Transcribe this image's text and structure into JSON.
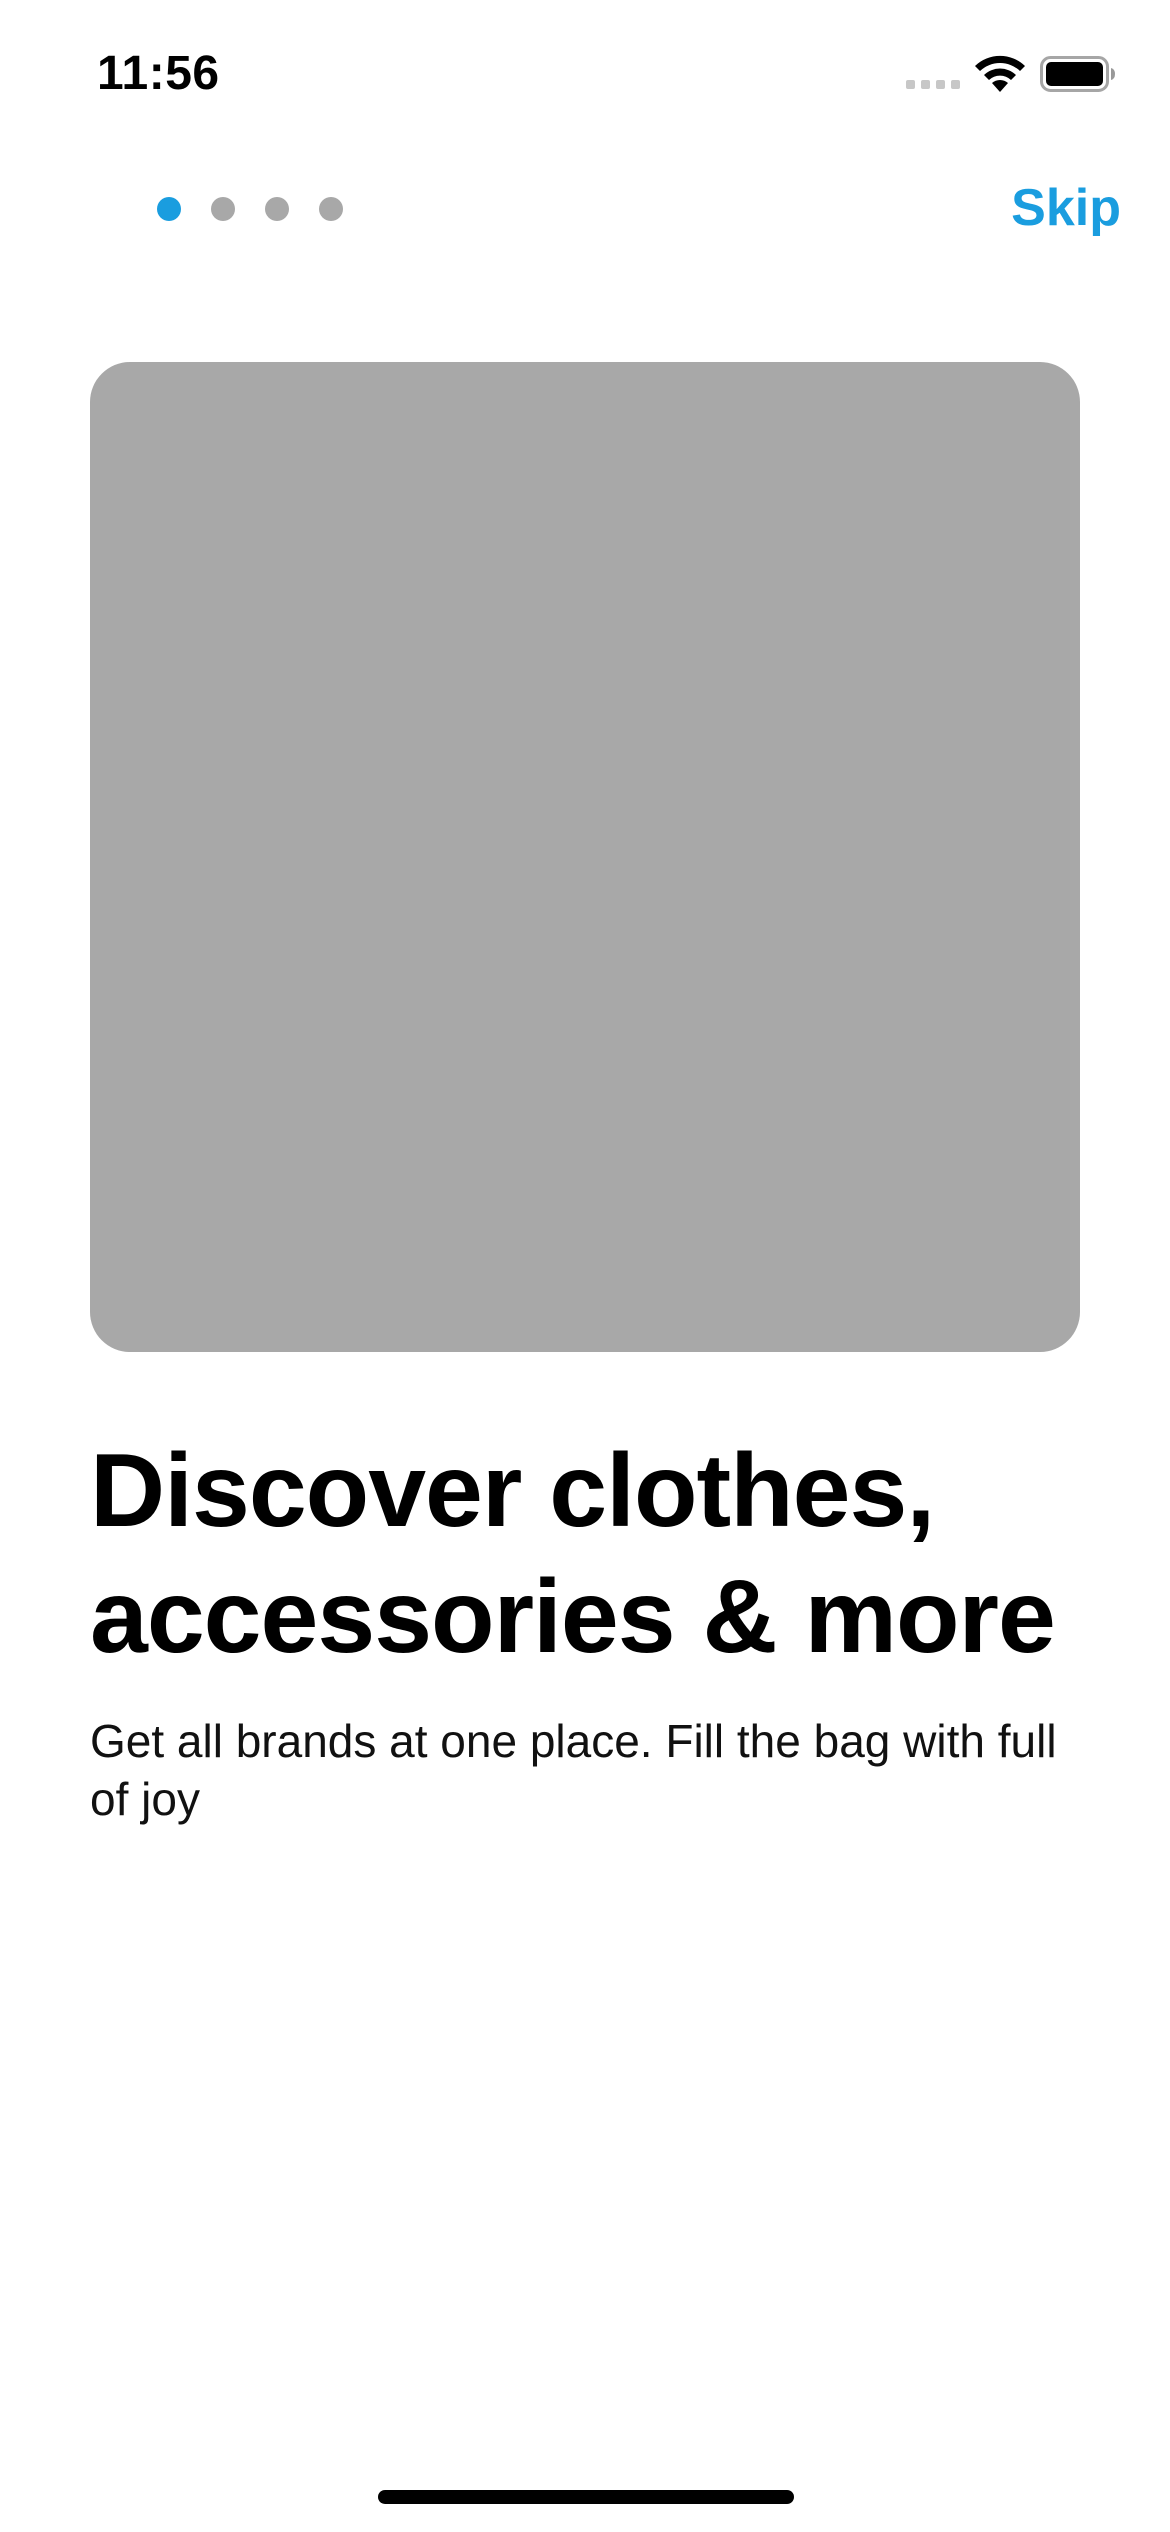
{
  "status_bar": {
    "time": "11:56",
    "icons": [
      "cellular-signal-icon",
      "wifi-icon",
      "battery-icon"
    ]
  },
  "onboarding": {
    "page_indicator": {
      "total_pages": 4,
      "current_page": 1
    },
    "skip_label": "Skip",
    "image_placeholder": "",
    "title": "Discover clothes, accessories & more",
    "subtitle": "Get all brands at one place. Fill the bag with full of joy"
  },
  "colors": {
    "accent": "#1a9ddf",
    "placeholder_gray": "#a8a8a8",
    "text": "#000000",
    "background": "#ffffff"
  }
}
